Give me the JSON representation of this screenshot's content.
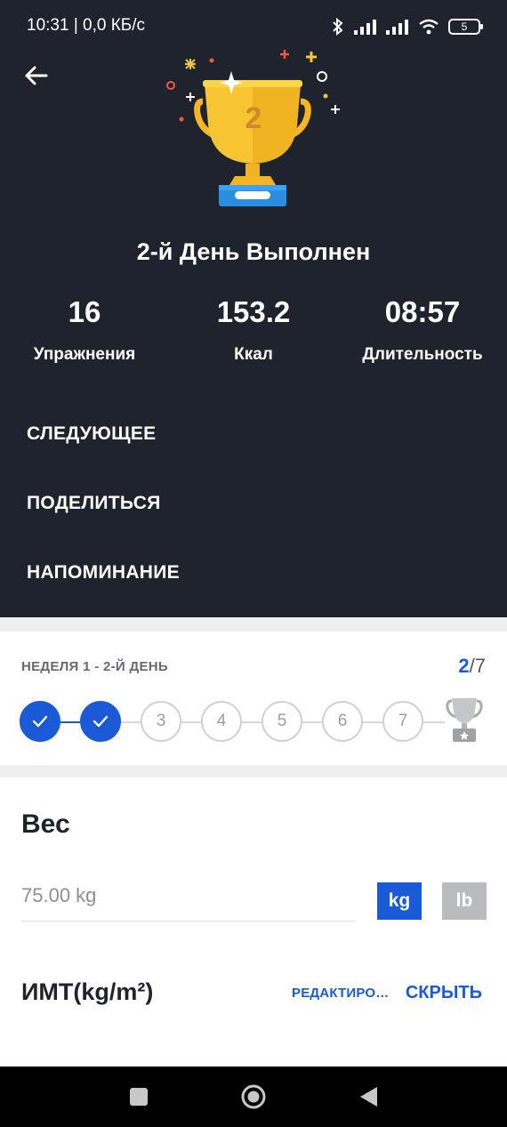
{
  "status_bar": {
    "time": "10:31 | 0,0 КБ/с",
    "battery": "5"
  },
  "header": {
    "title": "2-й День Выполнен",
    "trophy_rank": "2"
  },
  "stats": [
    {
      "value": "16",
      "label": "Упражнения"
    },
    {
      "value": "153.2",
      "label": "Ккал"
    },
    {
      "value": "08:57",
      "label": "Длительность"
    }
  ],
  "actions": {
    "next": "СЛЕДУЮЩЕЕ",
    "share": "ПОДЕЛИТЬСЯ",
    "reminder": "НАПОМИНАНИЕ"
  },
  "week": {
    "label": "НЕДЕЛЯ 1 - 2-Й ДЕНЬ",
    "current": "2",
    "total": "/7",
    "days": [
      "1",
      "2",
      "3",
      "4",
      "5",
      "6",
      "7"
    ],
    "completed_days": 2
  },
  "weight": {
    "heading": "Вес",
    "value": "75.00 kg",
    "unit_kg": "kg",
    "unit_lb": "lb",
    "selected_unit": "kg"
  },
  "bmi": {
    "heading": "ИМТ(kg/m²)",
    "edit_label": "РЕДАКТИРОВАТЬ",
    "hide_label": "СКРЫТЬ"
  },
  "colors": {
    "header_bg": "#1f232d",
    "accent": "#1a5ad7",
    "trophy_gold": "#f5c533",
    "inactive": "#b9bbbe"
  },
  "icons": {
    "back": "arrow-left-icon",
    "trophy": "trophy-icon",
    "check": "check-icon",
    "nav_recent": "square-icon",
    "nav_home": "circle-icon",
    "nav_back": "triangle-back-icon"
  }
}
